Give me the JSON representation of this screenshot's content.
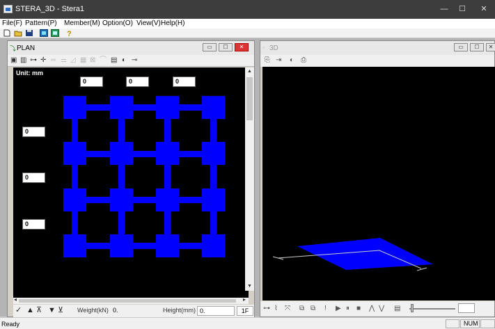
{
  "window": {
    "title": "STERA_3D - Stera1",
    "minimize": "—",
    "maximize": "☐",
    "close": "✕"
  },
  "menu": [
    "File(F)",
    "Pattern(P)",
    "Member(M)",
    "Option(O)",
    "View(V)",
    "Help(H)"
  ],
  "toolbar": {
    "icons": [
      "new-icon",
      "open-icon",
      "save-icon",
      "view-icon",
      "screen-icon",
      "help-icon"
    ]
  },
  "plan": {
    "title": "PLAN",
    "unit": "Unit: mm",
    "top_inputs": [
      "0",
      "0",
      "0"
    ],
    "left_inputs": [
      "0",
      "0",
      "0"
    ],
    "colors": {
      "member": "#0000ff",
      "background": "#000000"
    },
    "bottom": {
      "weight_label": "Weight(kN)",
      "weight_value": "0.",
      "height_label": "Height(mm)",
      "height_value": "0.",
      "floor": "1F"
    }
  },
  "view3d": {
    "title": "3D",
    "slab_color": "#0000ff"
  },
  "status": {
    "ready": "Ready",
    "num": "NUM"
  }
}
